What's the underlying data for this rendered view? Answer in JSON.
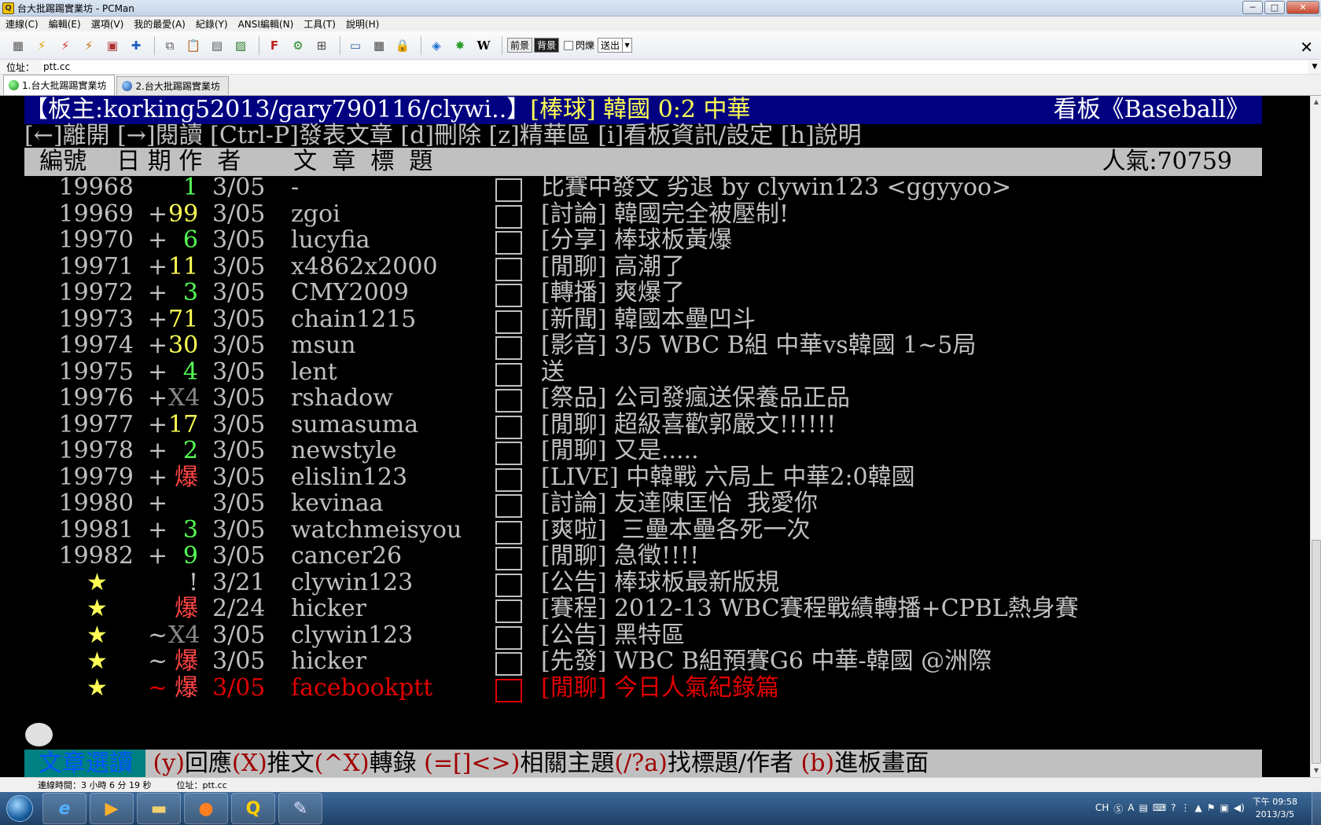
{
  "window": {
    "title": "台大批踢踢實業坊 - PCMan",
    "buttons": {
      "minimize": "─",
      "maximize": "□",
      "close": "✕"
    }
  },
  "menu": [
    "連線(C)",
    "編輯(E)",
    "選項(V)",
    "我的最愛(A)",
    "紀錄(Y)",
    "ANSI編輯(N)",
    "工具(T)",
    "說明(H)"
  ],
  "toolbar": {
    "fg_label": "前景",
    "bg_label": "背景",
    "blink_label": "閃爍",
    "send_select": "送出",
    "close_glyph": "✕"
  },
  "address": {
    "label": "位址：",
    "value": "ptt.cc"
  },
  "tabs": [
    {
      "label": "1.台大批踢踢實業坊",
      "active": true,
      "color": "#2ea02e"
    },
    {
      "label": "2.台大批踢踢實業坊",
      "active": false,
      "color": "#1f5fbf"
    }
  ],
  "terminal": {
    "header_left": "【板主:korking52013/gary790116/clywi..】",
    "header_mid": "[棒球] 韓國 0:2 中華",
    "header_right": "看板《Baseball》",
    "help_line": "[←]離開 [→]閱讀 [Ctrl-P]發表文章 [d]刪除 [z]精華區 [i]看板資訊/設定 [h]說明",
    "column_header": "  編號    日 期 作  者       文  章  標  題",
    "popularity": "人氣:70759",
    "rows": [
      {
        "num": "19968",
        "plus": " ",
        "rec": "1",
        "rec_color": "g",
        "date": "3/05",
        "author": "-",
        "title": "比賽中發文 劣退 by clywin123 <ggyyoo>"
      },
      {
        "num": "19969",
        "plus": "+",
        "rec": "99",
        "rec_color": "yl",
        "date": "3/05",
        "author": "zgoi",
        "title": "[討論] 韓國完全被壓制!"
      },
      {
        "num": "19970",
        "plus": "+",
        "rec": "6",
        "rec_color": "g",
        "date": "3/05",
        "author": "lucyfia",
        "title": "[分享] 棒球板黃爆"
      },
      {
        "num": "19971",
        "plus": "+",
        "rec": "11",
        "rec_color": "yl",
        "date": "3/05",
        "author": "x4862x2000",
        "title": "[閒聊] 高潮了"
      },
      {
        "num": "19972",
        "plus": "+",
        "rec": "3",
        "rec_color": "g",
        "date": "3/05",
        "author": "CMY2009",
        "title": "[轉播] 爽爆了"
      },
      {
        "num": "19973",
        "plus": "+",
        "rec": "71",
        "rec_color": "yl",
        "date": "3/05",
        "author": "chain1215",
        "title": "[新聞] 韓國本壘凹斗"
      },
      {
        "num": "19974",
        "plus": "+",
        "rec": "30",
        "rec_color": "yl",
        "date": "3/05",
        "author": "msun",
        "title": "[影音] 3/5 WBC B組 中華vs韓國 1~5局"
      },
      {
        "num": "19975",
        "plus": "+",
        "rec": "4",
        "rec_color": "g",
        "date": "3/05",
        "author": "lent",
        "title": "送"
      },
      {
        "num": "19976",
        "plus": "+",
        "rec": "X4",
        "rec_color": "gr",
        "date": "3/05",
        "author": "rshadow",
        "title": "[祭品] 公司發瘋送保養品正品"
      },
      {
        "num": "19977",
        "plus": "+",
        "rec": "17",
        "rec_color": "yl",
        "date": "3/05",
        "author": "sumasuma",
        "title": "[閒聊] 超級喜歡郭嚴文!!!!!!"
      },
      {
        "num": "19978",
        "plus": "+",
        "rec": "2",
        "rec_color": "g",
        "date": "3/05",
        "author": "newstyle",
        "title": "[閒聊] 又是....."
      },
      {
        "num": "19979",
        "plus": "+",
        "rec": "爆",
        "rec_color": "r",
        "date": "3/05",
        "author": "elislin123",
        "title": "[LIVE] 中韓戰 六局上 中華2:0韓國"
      },
      {
        "num": "19980",
        "plus": "+",
        "rec": "",
        "rec_color": "g",
        "date": "3/05",
        "author": "kevinaa",
        "title": "[討論] 友達陳匡怡  我愛你"
      },
      {
        "num": "19981",
        "plus": "+",
        "rec": "3",
        "rec_color": "g",
        "date": "3/05",
        "author": "watchmeisyou",
        "title": "[爽啦]  三壘本壘各死一次"
      },
      {
        "num": "19982",
        "plus": "+",
        "rec": "9",
        "rec_color": "g",
        "date": "3/05",
        "author": "cancer26",
        "title": "[閒聊] 急徵!!!!"
      }
    ],
    "pinned": [
      {
        "star": "★",
        "plus": "",
        "rec": "!",
        "rec_color": "plain",
        "date": "3/21",
        "author": "clywin123",
        "title": "[公告] 棒球板最新版規",
        "red": false
      },
      {
        "star": "★",
        "plus": "",
        "rec": "爆",
        "rec_color": "r",
        "date": "2/24",
        "author": "hicker",
        "title": "[賽程] 2012-13 WBC賽程戰績轉播+CPBL熱身賽",
        "red": false
      },
      {
        "star": "★",
        "plus": "~",
        "rec": "X4",
        "rec_color": "gr",
        "date": "3/05",
        "author": "clywin123",
        "title": "[公告] 黑特區",
        "red": false
      },
      {
        "star": "★",
        "plus": "~",
        "rec": "爆",
        "rec_color": "r",
        "date": "3/05",
        "author": "hicker",
        "title": "[先發] WBC B組預賽G6 中華-韓國 @洲際",
        "red": false
      },
      {
        "star": "★",
        "plus": "~",
        "rec": "爆",
        "rec_color": "r",
        "date": "3/05",
        "author": "facebookptt",
        "title": "[閒聊] 今日人氣紀錄篇",
        "red": true
      }
    ],
    "footer_label": "文章選讀",
    "footer_keys": [
      {
        "k": " (y)",
        "t": "回應"
      },
      {
        "k": "(X)",
        "t": "推文"
      },
      {
        "k": "(^X)",
        "t": "轉錄 "
      },
      {
        "k": "(=[]<>)",
        "t": "相關主題"
      },
      {
        "k": "(/?a)",
        "t": "找標題/作者 "
      },
      {
        "k": "(b)",
        "t": "進板畫面"
      }
    ]
  },
  "statusbar": {
    "connect_time": "連線時間：3 小時 6 分 19 秒",
    "address": "位址：ptt.cc"
  },
  "taskbar": {
    "tray_lang": "CH",
    "clock_time": "下午 09:58",
    "clock_date": "2013/3/5"
  }
}
